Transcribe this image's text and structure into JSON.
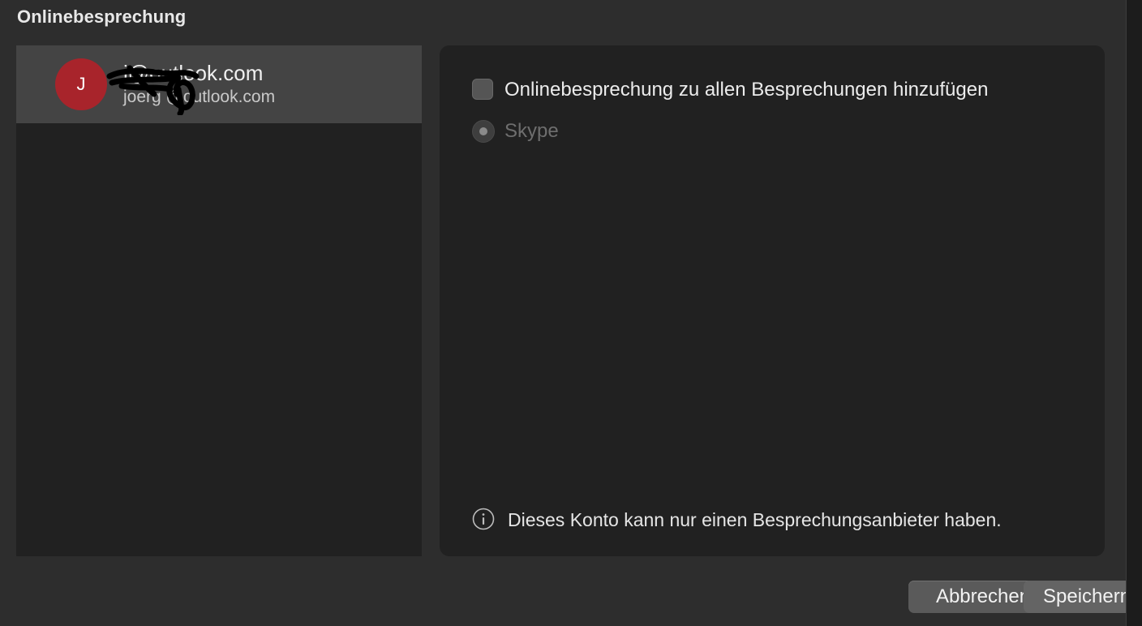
{
  "dialog": {
    "title": "Onlinebesprechung"
  },
  "accounts": [
    {
      "avatar_initial": "J",
      "avatar_color": "#a8242b",
      "name": "i@outlook.com",
      "email": "joerg @outlook.com"
    }
  ],
  "settings": {
    "checkbox_label": "Onlinebesprechung zu allen Besprechungen hinzufügen",
    "checkbox_checked": false,
    "radio_label": "Skype",
    "radio_disabled": true,
    "info_text": "Dieses Konto kann nur einen Besprechungsanbieter haben."
  },
  "buttons": {
    "cancel_label": "Abbrechen",
    "save_label": "Speichern"
  },
  "icons": {
    "info": "info-circle-icon"
  }
}
